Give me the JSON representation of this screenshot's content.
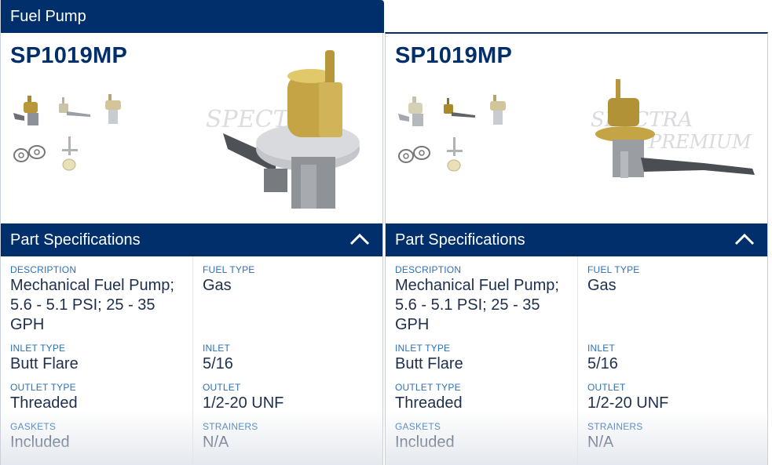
{
  "category_tab": {
    "label": "Fuel Pump"
  },
  "watermark": "SPECTRA PREMIUM",
  "cards": [
    {
      "part_number": "SP1019MP",
      "spec_section_title": "Part Specifications",
      "collapse_icon": "chevron-up-icon",
      "specs": {
        "description": {
          "label": "DESCRIPTION",
          "value": "Mechanical Fuel Pump; 5.6 - 5.1 PSI; 25 - 35 GPH"
        },
        "fuel_type": {
          "label": "FUEL TYPE",
          "value": "Gas"
        },
        "inlet_type": {
          "label": "INLET TYPE",
          "value": "Butt Flare"
        },
        "inlet": {
          "label": "INLET",
          "value": "5/16"
        },
        "outlet_type": {
          "label": "OUTLET TYPE",
          "value": "Threaded"
        },
        "outlet": {
          "label": "OUTLET",
          "value": "1/2-20 UNF"
        },
        "gaskets": {
          "label": "GASKETS",
          "value": "Included"
        },
        "strainers": {
          "label": "STRAINERS",
          "value": "N/A"
        }
      }
    },
    {
      "part_number": "SP1019MP",
      "spec_section_title": "Part Specifications",
      "collapse_icon": "chevron-up-icon",
      "specs": {
        "description": {
          "label": "DESCRIPTION",
          "value": "Mechanical Fuel Pump; 5.6 - 5.1 PSI; 25 - 35 GPH"
        },
        "fuel_type": {
          "label": "FUEL TYPE",
          "value": "Gas"
        },
        "inlet_type": {
          "label": "INLET TYPE",
          "value": "Butt Flare"
        },
        "inlet": {
          "label": "INLET",
          "value": "5/16"
        },
        "outlet_type": {
          "label": "OUTLET TYPE",
          "value": "Threaded"
        },
        "outlet": {
          "label": "OUTLET",
          "value": "1/2-20 UNF"
        },
        "gaskets": {
          "label": "GASKETS",
          "value": "Included"
        },
        "strainers": {
          "label": "STRAINERS",
          "value": "N/A"
        }
      }
    }
  ]
}
